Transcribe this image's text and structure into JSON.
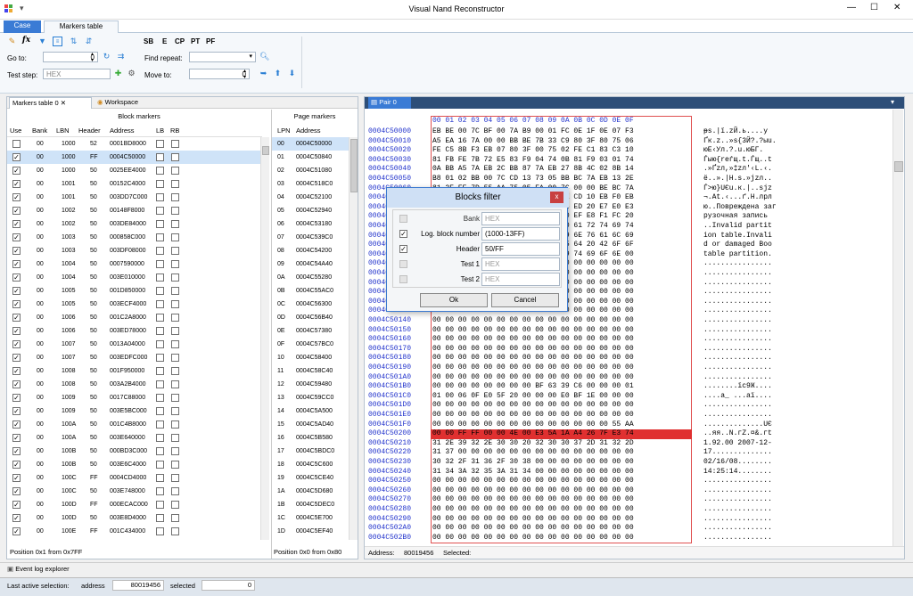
{
  "app": {
    "title": "Visual Nand Reconstructor",
    "minimize": "—",
    "maximize": "☐",
    "close": "✕"
  },
  "tabs": [
    "Case",
    "Markers table"
  ],
  "toolbar": {
    "bold_labels": [
      "SB",
      "E",
      "CP",
      "PT",
      "PF"
    ],
    "goto_label": "Go to:",
    "goto_value": "0",
    "find_repeat_label": "Find repeat:",
    "test_step_label": "Test step:",
    "test_step_placeholder": "HEX",
    "move_to_label": "Move to:",
    "move_to_value": "0"
  },
  "left_tabs": [
    "Markers table 0",
    "Workspace"
  ],
  "block_markers": {
    "title": "Block markers",
    "headers": [
      "Use",
      "Bank",
      "LBN",
      "Header",
      "Address",
      "LB",
      "RB"
    ],
    "rows": [
      [
        "0",
        "00",
        "1000",
        "52",
        "0001BD8000"
      ],
      [
        "1",
        "00",
        "1000",
        "FF",
        "0004C50000"
      ],
      [
        "1",
        "00",
        "1000",
        "50",
        "0025EE4000"
      ],
      [
        "1",
        "00",
        "1001",
        "50",
        "00152C4000"
      ],
      [
        "1",
        "00",
        "1001",
        "50",
        "003DD7C000"
      ],
      [
        "1",
        "00",
        "1002",
        "50",
        "00148F8000"
      ],
      [
        "1",
        "00",
        "1002",
        "50",
        "003DE84000"
      ],
      [
        "1",
        "00",
        "1003",
        "50",
        "000858C000"
      ],
      [
        "1",
        "00",
        "1003",
        "50",
        "003DF08000"
      ],
      [
        "1",
        "00",
        "1004",
        "50",
        "0007590000"
      ],
      [
        "1",
        "00",
        "1004",
        "50",
        "003E010000"
      ],
      [
        "1",
        "00",
        "1005",
        "50",
        "001D850000"
      ],
      [
        "1",
        "00",
        "1005",
        "50",
        "003ECF4000"
      ],
      [
        "1",
        "00",
        "1006",
        "50",
        "001C2A8000"
      ],
      [
        "1",
        "00",
        "1006",
        "50",
        "003ED78000"
      ],
      [
        "1",
        "00",
        "1007",
        "50",
        "0013A04000"
      ],
      [
        "1",
        "00",
        "1007",
        "50",
        "003EDFC000"
      ],
      [
        "1",
        "00",
        "1008",
        "50",
        "001F950000"
      ],
      [
        "1",
        "00",
        "1008",
        "50",
        "003A2B4000"
      ],
      [
        "1",
        "00",
        "1009",
        "50",
        "0017C88000"
      ],
      [
        "1",
        "00",
        "1009",
        "50",
        "003E5BC000"
      ],
      [
        "1",
        "00",
        "100A",
        "50",
        "001C4B8000"
      ],
      [
        "1",
        "00",
        "100A",
        "50",
        "003E640000"
      ],
      [
        "1",
        "00",
        "100B",
        "50",
        "000BD3C000"
      ],
      [
        "1",
        "00",
        "100B",
        "50",
        "003E6C4000"
      ],
      [
        "1",
        "00",
        "100C",
        "FF",
        "0004CD4000"
      ],
      [
        "1",
        "00",
        "100C",
        "50",
        "003E748000"
      ],
      [
        "1",
        "00",
        "100D",
        "FF",
        "000ECAC000"
      ],
      [
        "1",
        "00",
        "100D",
        "50",
        "003E8D4000"
      ],
      [
        "1",
        "00",
        "100E",
        "FF",
        "001C434000"
      ]
    ],
    "footer": "Position 0x1 from 0x7FF"
  },
  "page_markers": {
    "title": "Page markers",
    "headers": [
      "LPN",
      "Address"
    ],
    "rows": [
      [
        "00",
        "0004C50000"
      ],
      [
        "01",
        "0004C50840"
      ],
      [
        "02",
        "0004C51080"
      ],
      [
        "03",
        "0004C518C0"
      ],
      [
        "04",
        "0004C52100"
      ],
      [
        "05",
        "0004C52940"
      ],
      [
        "06",
        "0004C53180"
      ],
      [
        "07",
        "0004C539C0"
      ],
      [
        "08",
        "0004C54200"
      ],
      [
        "09",
        "0004C54A40"
      ],
      [
        "0A",
        "0004C55280"
      ],
      [
        "0B",
        "0004C55AC0"
      ],
      [
        "0C",
        "0004C56300"
      ],
      [
        "0D",
        "0004C56B40"
      ],
      [
        "0E",
        "0004C57380"
      ],
      [
        "0F",
        "0004C57BC0"
      ],
      [
        "10",
        "0004C58400"
      ],
      [
        "11",
        "0004C58C40"
      ],
      [
        "12",
        "0004C59480"
      ],
      [
        "13",
        "0004C59CC0"
      ],
      [
        "14",
        "0004C5A500"
      ],
      [
        "15",
        "0004C5AD40"
      ],
      [
        "16",
        "0004C5B580"
      ],
      [
        "17",
        "0004C5BDC0"
      ],
      [
        "18",
        "0004C5C600"
      ],
      [
        "19",
        "0004C5CE40"
      ],
      [
        "1A",
        "0004C5D680"
      ],
      [
        "1B",
        "0004C5DEC0"
      ],
      [
        "1C",
        "0004C5E700"
      ],
      [
        "1D",
        "0004C5EF40"
      ]
    ],
    "footer": "Position 0x0 from 0x80"
  },
  "pair_tab": "Pair 0",
  "hex": {
    "header": "00 01 02 03 04 05 06 07 08 09 0A 0B 0C 0D 0E 0F",
    "rows": [
      [
        "0004C50000",
        "EB BE 00 7C BF 00 7A B9 00 01 FC 0E 1F 0E 07 F3",
        "ᵽs.|ї.zЙ.ь....у"
      ],
      [
        "0004C50010",
        "A5 EA 16 7A 00 00 BB BE 7B 33 C9 80 3F 80 75 06",
        "Ґк.z..»ѕ{3Й?.?ыu."
      ],
      [
        "0004C50020",
        "FE C5 8B F3 EB 07 80 3F 00 75 02 FE C1 83 C3 10",
        "юЕ‹Ул.?.u.юБГ."
      ],
      [
        "0004C50030",
        "81 FB FE 7B 72 E5 83 F9 04 74 0B 81 F9 03 01 74",
        "Ѓыю{reѓщ.t.Ѓщ..t"
      ],
      [
        "0004C50040",
        "0A BB A5 7A EB 2C BB 87 7A EB 27 8B 4C 02 8B 14",
        ".»Ґzл,»‡zл'‹L.‹."
      ],
      [
        "0004C50050",
        "B8 01 02 BB 00 7C CD 13 73 05 BB BC 7A EB 13 2E",
        "ё..».|Н.s.»јzл.."
      ],
      [
        "0004C50060",
        "81 3E FE 7D 55 AA 75 05 EA 00 7C 00 00 BE BC 7A",
        "Ѓ>ю}UЄu.к.|..ѕјz"
      ],
      [
        "0004C50070",
        "AC 0A C0 74 0C 8B 1E 07 00 B4 0E CD 10 EB F0 EB",
        "¬.Аt.‹...ґ.Н.лрл"
      ],
      [
        "0004C50080",
        "FE 0D 0A CF EE E2 F0 E5 E6 E4 E5 ED 20 E7 E0 E3",
        "ю..Повреждена заг"
      ],
      [
        "0004C50090",
        "F0 F3 E7 EE F7 ED E0 FF 20 E7 E0 EF E8 F1 FC 20",
        "рузочная запись "
      ],
      [
        "0004C500A0",
        "0D 0A 49 6E 76 61 6C 69 64 20 70 61 72 74 69 74",
        "..Invalid partit"
      ],
      [
        "0004C500B0",
        "69 6F 6E 20 74 61 62 6C 65 2E 49 6E 76 61 6C 69",
        "ion table.Invali"
      ],
      [
        "0004C500C0",
        "64 20 6F 72 20 64 61 6D 61 67 65 64 20 42 6F 6F",
        "d or damaged Boo"
      ],
      [
        "0004C500D0",
        "74 61 62 6C 65 20 70 61 72 74 69 74 69 6F 6E 00",
        "table partition."
      ],
      [
        "0004C500E0",
        "00 00 00 00 00 00 00 00 00 00 00 00 00 00 00 00",
        "................"
      ],
      [
        "0004C500F0",
        "00 00 00 00 00 00 00 00 00 00 00 00 00 00 00 00",
        "................"
      ],
      [
        "0004C50100",
        "00 00 00 00 00 00 00 00 00 00 00 00 00 00 00 00",
        "................"
      ],
      [
        "0004C50110",
        "00 00 00 00 00 00 00 00 00 00 00 00 00 00 00 00",
        "................"
      ],
      [
        "0004C50120",
        "00 00 00 00 00 00 00 00 00 00 00 00 00 00 00 00",
        "................"
      ],
      [
        "0004C50130",
        "00 00 00 00 00 00 00 00 00 00 00 00 00 00 00 00",
        "................"
      ],
      [
        "0004C50140",
        "00 00 00 00 00 00 00 00 00 00 00 00 00 00 00 00",
        "................"
      ],
      [
        "0004C50150",
        "00 00 00 00 00 00 00 00 00 00 00 00 00 00 00 00",
        "................"
      ],
      [
        "0004C50160",
        "00 00 00 00 00 00 00 00 00 00 00 00 00 00 00 00",
        "................"
      ],
      [
        "0004C50170",
        "00 00 00 00 00 00 00 00 00 00 00 00 00 00 00 00",
        "................"
      ],
      [
        "0004C50180",
        "00 00 00 00 00 00 00 00 00 00 00 00 00 00 00 00",
        "................"
      ],
      [
        "0004C50190",
        "00 00 00 00 00 00 00 00 00 00 00 00 00 00 00 00",
        "................"
      ],
      [
        "0004C501A0",
        "00 00 00 00 00 00 00 00 00 00 00 00 00 00 00 00",
        "................"
      ],
      [
        "0004C501B0",
        "00 00 00 00 00 00 00 00 BF 63 39 C6 00 00 00 01",
        "........їc9Ж...."
      ],
      [
        "0004C501C0",
        "01 00 06 0F E0 5F 20 00 00 00 E0 BF 1E 00 00 00",
        "....а_ ...аї...."
      ],
      [
        "0004C501D0",
        "00 00 00 00 00 00 00 00 00 00 00 00 00 00 00 00",
        "................"
      ],
      [
        "0004C501E0",
        "00 00 00 00 00 00 00 00 00 00 00 00 00 00 00 00",
        "................"
      ],
      [
        "0004C501F0",
        "00 00 00 00 00 00 00 00 00 00 00 00 00 00 55 AA",
        "..............UЄ"
      ],
      [
        "0004C50200",
        "00 00 FF FF 00 00 4E 00 E3 5A 1A A4 26 7F E3 74",
        "..яя..N.гZ.¤&.гt"
      ],
      [
        "0004C50210",
        "31 2E 39 32 2E 30 30 20 32 30 30 37 2D 31 32 2D",
        "1.92.00 2007-12-"
      ],
      [
        "0004C50220",
        "31 37 00 00 00 00 00 00 00 00 00 00 00 00 00 00",
        "17.............."
      ],
      [
        "0004C50230",
        "30 32 2F 31 36 2F 30 38 00 00 00 00 00 00 00 00",
        "02/16/08........"
      ],
      [
        "0004C50240",
        "31 34 3A 32 35 3A 31 34 00 00 00 00 00 00 00 00",
        "14:25:14........"
      ],
      [
        "0004C50250",
        "00 00 00 00 00 00 00 00 00 00 00 00 00 00 00 00",
        "................"
      ],
      [
        "0004C50260",
        "00 00 00 00 00 00 00 00 00 00 00 00 00 00 00 00",
        "................"
      ],
      [
        "0004C50270",
        "00 00 00 00 00 00 00 00 00 00 00 00 00 00 00 00",
        "................"
      ],
      [
        "0004C50280",
        "00 00 00 00 00 00 00 00 00 00 00 00 00 00 00 00",
        "................"
      ],
      [
        "0004C50290",
        "00 00 00 00 00 00 00 00 00 00 00 00 00 00 00 00",
        "................"
      ],
      [
        "0004C502A0",
        "00 00 00 00 00 00 00 00 00 00 00 00 00 00 00 00",
        "................"
      ],
      [
        "0004C502B0",
        "00 00 00 00 00 00 00 00 00 00 00 00 00 00 00 00",
        "................"
      ]
    ],
    "footer_address_label": "Address:",
    "footer_address": "80019456",
    "footer_selected_label": "Selected:"
  },
  "dialog": {
    "title": "Blocks filter",
    "close": "x",
    "rows": [
      {
        "label": "Bank",
        "value": "",
        "placeholder": "HEX",
        "checked": "0"
      },
      {
        "label": "Log. block number",
        "value": "(1000-13FF)",
        "placeholder": "",
        "checked": "1"
      },
      {
        "label": "Header",
        "value": "50/FF",
        "placeholder": "",
        "checked": "1"
      },
      {
        "label": "Test 1",
        "value": "",
        "placeholder": "HEX",
        "checked": "0"
      },
      {
        "label": "Test 2",
        "value": "",
        "placeholder": "HEX",
        "checked": "0"
      }
    ],
    "ok": "Ok",
    "cancel": "Cancel"
  },
  "event_log": "Event log explorer",
  "status": {
    "label": "Last active selection:",
    "address_label": "address",
    "address": "80019456",
    "selected_label": "selected",
    "selected": "0"
  },
  "colors": {
    "accent": "#3a7bd5",
    "highlight_row": "#e03030",
    "select_box": "#e05050",
    "address_blue": "#2233cc"
  }
}
